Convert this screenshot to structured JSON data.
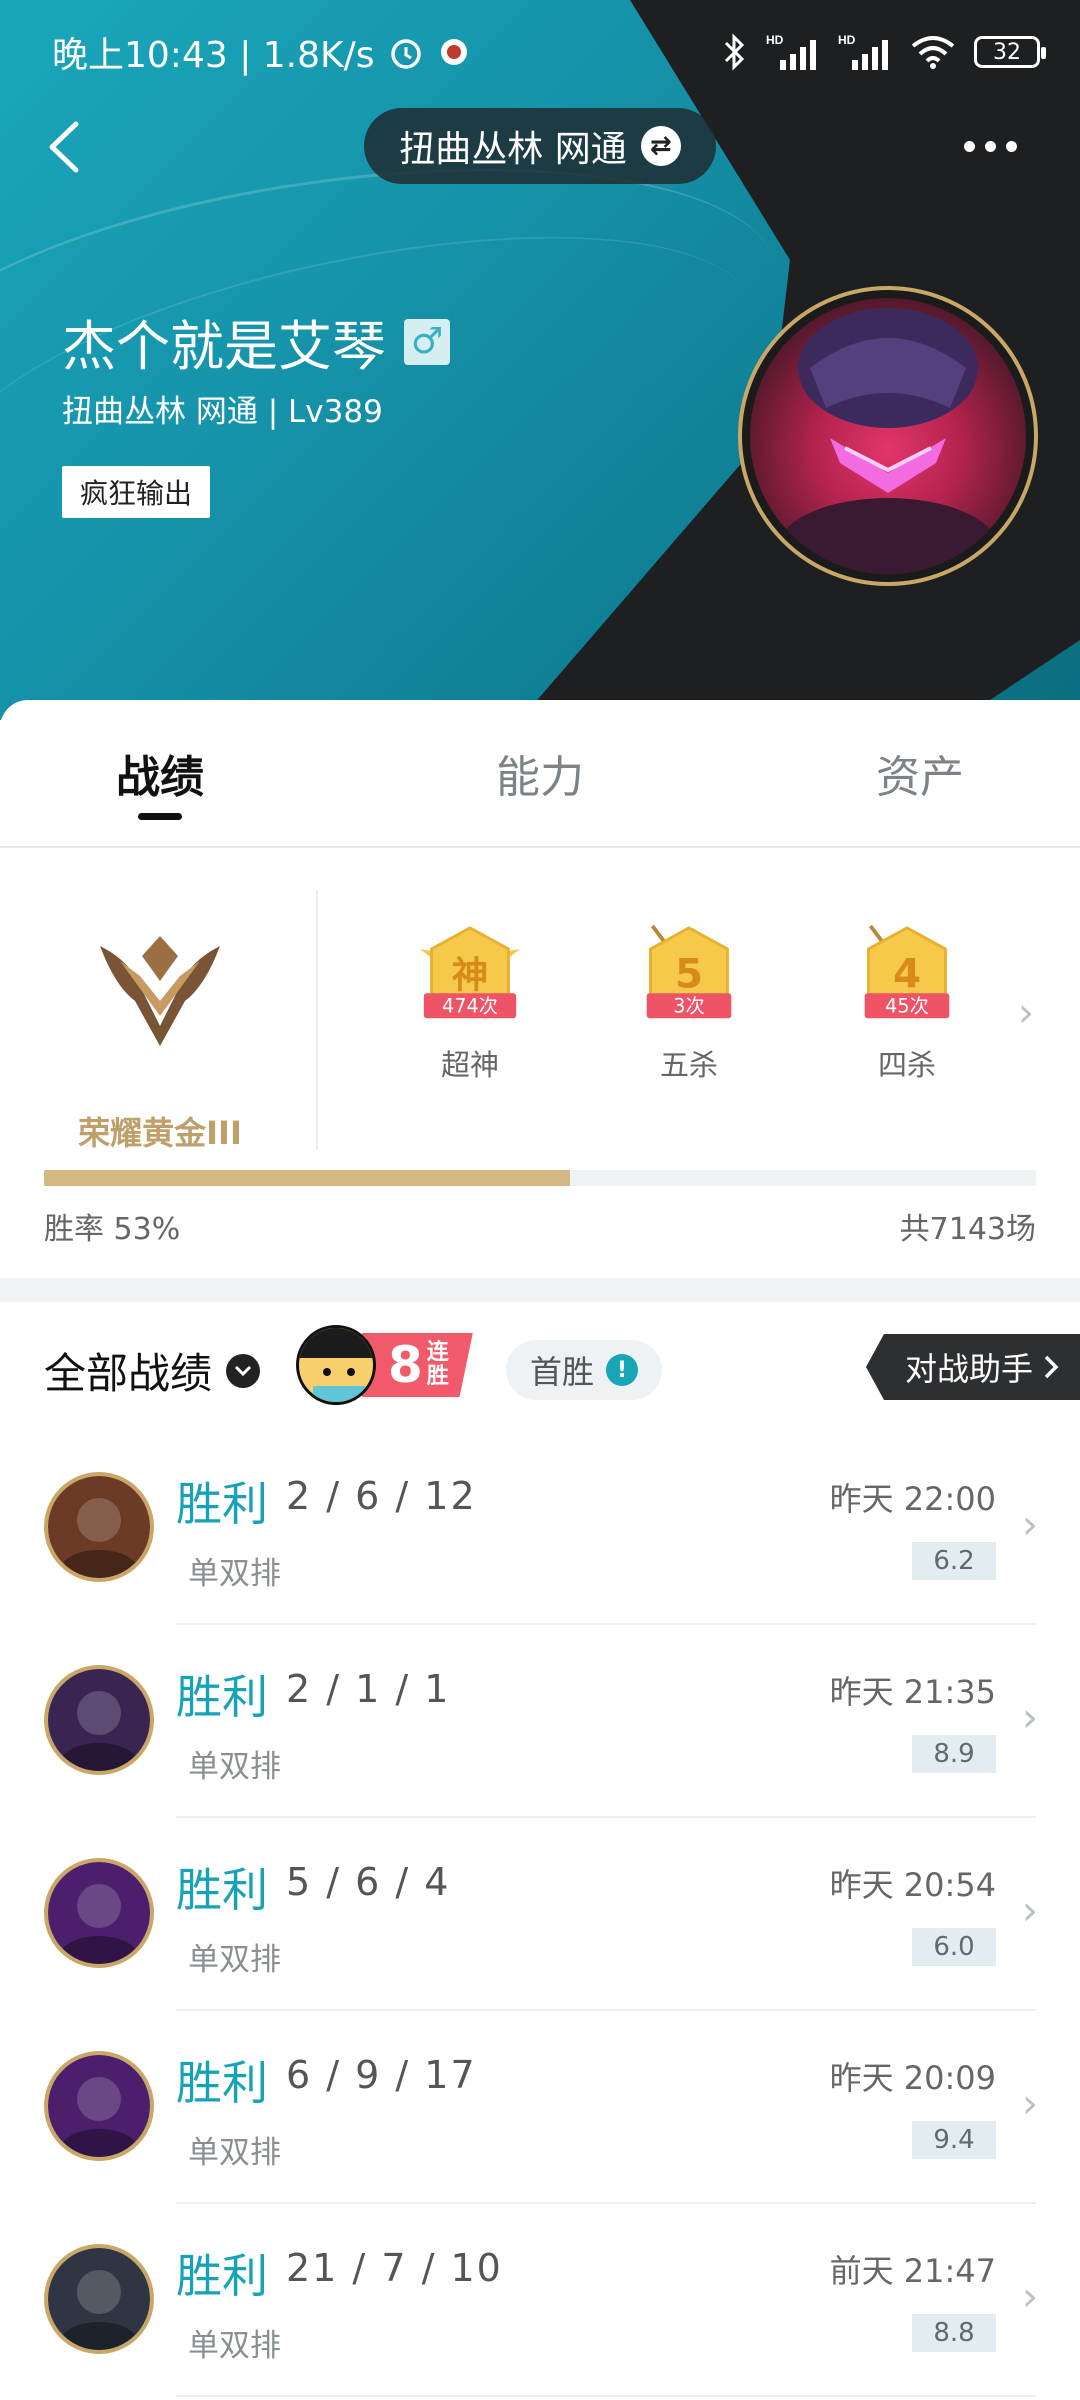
{
  "status_bar": {
    "time_speed": "晚上10:43 | 1.8K/s",
    "battery": "32"
  },
  "header": {
    "server_selector": "扭曲丛林 网通"
  },
  "profile": {
    "name": "杰个就是艾琴",
    "server_level": "扭曲丛林 网通 | Lv389",
    "tag": "疯狂输出"
  },
  "tabs": [
    {
      "label": "战绩",
      "active": true
    },
    {
      "label": "能力",
      "active": false
    },
    {
      "label": "资产",
      "active": false
    }
  ],
  "rank": {
    "name": "荣耀黄金III"
  },
  "medals": [
    {
      "glyph": "神",
      "count": "474次",
      "label": "超神"
    },
    {
      "glyph": "5",
      "count": "3次",
      "label": "五杀"
    },
    {
      "glyph": "4",
      "count": "45次",
      "label": "四杀"
    }
  ],
  "win_stats": {
    "win_rate_label": "胜率  53%",
    "win_rate": 0.53,
    "total_games": "共7143场"
  },
  "records_header": {
    "filter_label": "全部战绩",
    "streak_number": "8",
    "streak_text": "连胜",
    "first_win_label": "首胜",
    "assistant_label": "对战助手"
  },
  "matches": [
    {
      "result": "胜利",
      "kda": "2 / 6 / 12",
      "mode": "单双排",
      "time": "昨天 22:00",
      "score": "6.2",
      "champ_color": "#6b3b25"
    },
    {
      "result": "胜利",
      "kda": "2 / 1 / 1",
      "mode": "单双排",
      "time": "昨天 21:35",
      "score": "8.9",
      "champ_color": "#3a2452"
    },
    {
      "result": "胜利",
      "kda": "5 / 6 / 4",
      "mode": "单双排",
      "time": "昨天 20:54",
      "score": "6.0",
      "champ_color": "#4b1f6b"
    },
    {
      "result": "胜利",
      "kda": "6 / 9 / 17",
      "mode": "单双排",
      "time": "昨天 20:09",
      "score": "9.4",
      "champ_color": "#4b1f6b"
    },
    {
      "result": "胜利",
      "kda": "21 / 7 / 10",
      "mode": "单双排",
      "time": "前天 21:47",
      "score": "8.8",
      "champ_color": "#2f3542"
    }
  ]
}
